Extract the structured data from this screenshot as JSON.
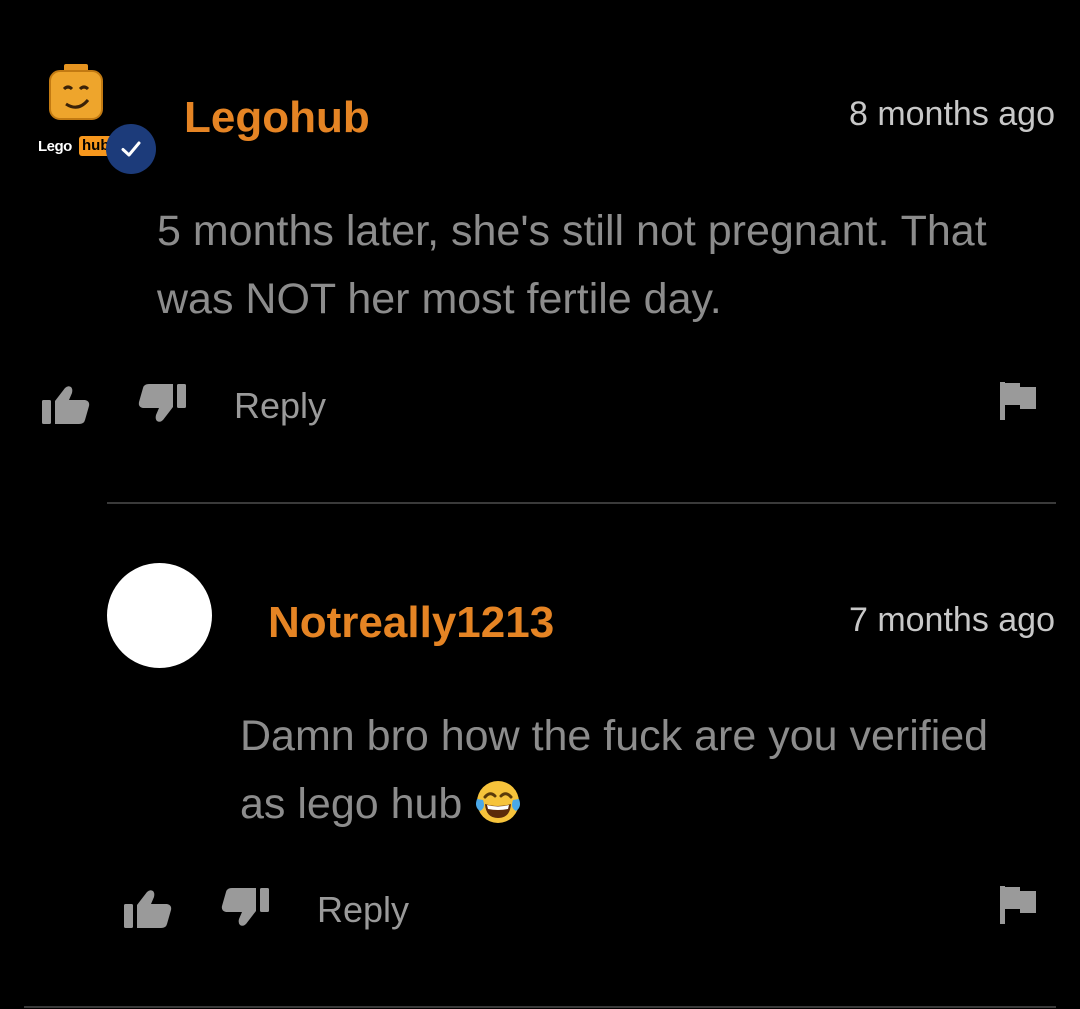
{
  "comments": [
    {
      "username": "Legohub",
      "timestamp": "8 months ago",
      "text_line1": "5 months later, she's still not pregnant. That",
      "text_line2": "was NOT her most fertile day.",
      "reply_label": "Reply",
      "avatar": {
        "brand_left": "Lego",
        "brand_right": "hub",
        "verified": true
      }
    },
    {
      "username": "Notreally1213",
      "timestamp": "7 months ago",
      "text_line1": "Damn bro how the fuck are you verified",
      "text_line2": "as lego hub",
      "emoji": "face-with-tears-of-joy",
      "reply_label": "Reply"
    }
  ],
  "colors": {
    "background": "#000000",
    "username": "#e58424",
    "timestamp": "#c8c8c8",
    "comment_text": "#8c8c8c",
    "action_icons": "#9a9a9a",
    "verified_badge": "#1c3b7a",
    "brand_hub": "#f7971d"
  },
  "icons": [
    "thumbs-up-icon",
    "thumbs-down-icon",
    "flag-icon",
    "verified-check-icon"
  ]
}
